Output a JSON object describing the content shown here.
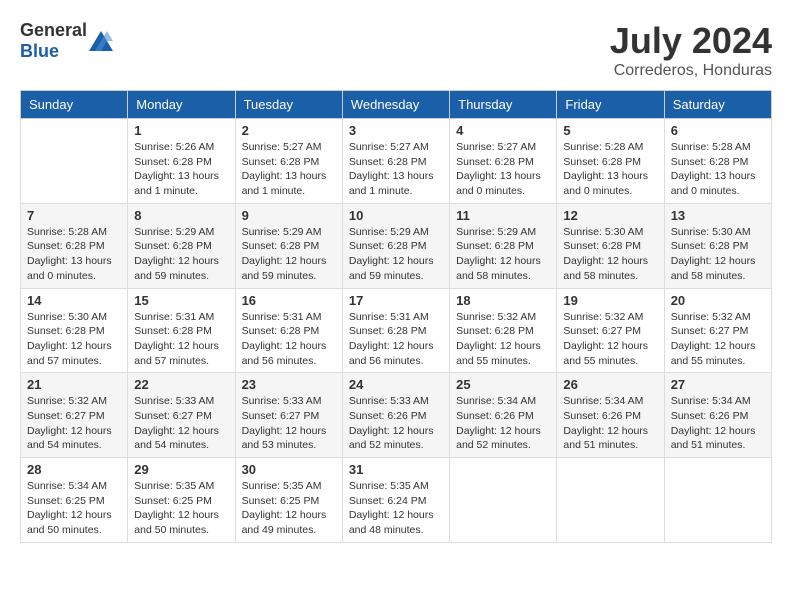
{
  "header": {
    "logo_general": "General",
    "logo_blue": "Blue",
    "month_year": "July 2024",
    "location": "Correderos, Honduras"
  },
  "days_of_week": [
    "Sunday",
    "Monday",
    "Tuesday",
    "Wednesday",
    "Thursday",
    "Friday",
    "Saturday"
  ],
  "weeks": [
    [
      {
        "day": "",
        "info": ""
      },
      {
        "day": "1",
        "info": "Sunrise: 5:26 AM\nSunset: 6:28 PM\nDaylight: 13 hours\nand 1 minute."
      },
      {
        "day": "2",
        "info": "Sunrise: 5:27 AM\nSunset: 6:28 PM\nDaylight: 13 hours\nand 1 minute."
      },
      {
        "day": "3",
        "info": "Sunrise: 5:27 AM\nSunset: 6:28 PM\nDaylight: 13 hours\nand 1 minute."
      },
      {
        "day": "4",
        "info": "Sunrise: 5:27 AM\nSunset: 6:28 PM\nDaylight: 13 hours\nand 0 minutes."
      },
      {
        "day": "5",
        "info": "Sunrise: 5:28 AM\nSunset: 6:28 PM\nDaylight: 13 hours\nand 0 minutes."
      },
      {
        "day": "6",
        "info": "Sunrise: 5:28 AM\nSunset: 6:28 PM\nDaylight: 13 hours\nand 0 minutes."
      }
    ],
    [
      {
        "day": "7",
        "info": "Sunrise: 5:28 AM\nSunset: 6:28 PM\nDaylight: 13 hours\nand 0 minutes."
      },
      {
        "day": "8",
        "info": "Sunrise: 5:29 AM\nSunset: 6:28 PM\nDaylight: 12 hours\nand 59 minutes."
      },
      {
        "day": "9",
        "info": "Sunrise: 5:29 AM\nSunset: 6:28 PM\nDaylight: 12 hours\nand 59 minutes."
      },
      {
        "day": "10",
        "info": "Sunrise: 5:29 AM\nSunset: 6:28 PM\nDaylight: 12 hours\nand 59 minutes."
      },
      {
        "day": "11",
        "info": "Sunrise: 5:29 AM\nSunset: 6:28 PM\nDaylight: 12 hours\nand 58 minutes."
      },
      {
        "day": "12",
        "info": "Sunrise: 5:30 AM\nSunset: 6:28 PM\nDaylight: 12 hours\nand 58 minutes."
      },
      {
        "day": "13",
        "info": "Sunrise: 5:30 AM\nSunset: 6:28 PM\nDaylight: 12 hours\nand 58 minutes."
      }
    ],
    [
      {
        "day": "14",
        "info": "Sunrise: 5:30 AM\nSunset: 6:28 PM\nDaylight: 12 hours\nand 57 minutes."
      },
      {
        "day": "15",
        "info": "Sunrise: 5:31 AM\nSunset: 6:28 PM\nDaylight: 12 hours\nand 57 minutes."
      },
      {
        "day": "16",
        "info": "Sunrise: 5:31 AM\nSunset: 6:28 PM\nDaylight: 12 hours\nand 56 minutes."
      },
      {
        "day": "17",
        "info": "Sunrise: 5:31 AM\nSunset: 6:28 PM\nDaylight: 12 hours\nand 56 minutes."
      },
      {
        "day": "18",
        "info": "Sunrise: 5:32 AM\nSunset: 6:28 PM\nDaylight: 12 hours\nand 55 minutes."
      },
      {
        "day": "19",
        "info": "Sunrise: 5:32 AM\nSunset: 6:27 PM\nDaylight: 12 hours\nand 55 minutes."
      },
      {
        "day": "20",
        "info": "Sunrise: 5:32 AM\nSunset: 6:27 PM\nDaylight: 12 hours\nand 55 minutes."
      }
    ],
    [
      {
        "day": "21",
        "info": "Sunrise: 5:32 AM\nSunset: 6:27 PM\nDaylight: 12 hours\nand 54 minutes."
      },
      {
        "day": "22",
        "info": "Sunrise: 5:33 AM\nSunset: 6:27 PM\nDaylight: 12 hours\nand 54 minutes."
      },
      {
        "day": "23",
        "info": "Sunrise: 5:33 AM\nSunset: 6:27 PM\nDaylight: 12 hours\nand 53 minutes."
      },
      {
        "day": "24",
        "info": "Sunrise: 5:33 AM\nSunset: 6:26 PM\nDaylight: 12 hours\nand 52 minutes."
      },
      {
        "day": "25",
        "info": "Sunrise: 5:34 AM\nSunset: 6:26 PM\nDaylight: 12 hours\nand 52 minutes."
      },
      {
        "day": "26",
        "info": "Sunrise: 5:34 AM\nSunset: 6:26 PM\nDaylight: 12 hours\nand 51 minutes."
      },
      {
        "day": "27",
        "info": "Sunrise: 5:34 AM\nSunset: 6:26 PM\nDaylight: 12 hours\nand 51 minutes."
      }
    ],
    [
      {
        "day": "28",
        "info": "Sunrise: 5:34 AM\nSunset: 6:25 PM\nDaylight: 12 hours\nand 50 minutes."
      },
      {
        "day": "29",
        "info": "Sunrise: 5:35 AM\nSunset: 6:25 PM\nDaylight: 12 hours\nand 50 minutes."
      },
      {
        "day": "30",
        "info": "Sunrise: 5:35 AM\nSunset: 6:25 PM\nDaylight: 12 hours\nand 49 minutes."
      },
      {
        "day": "31",
        "info": "Sunrise: 5:35 AM\nSunset: 6:24 PM\nDaylight: 12 hours\nand 48 minutes."
      },
      {
        "day": "",
        "info": ""
      },
      {
        "day": "",
        "info": ""
      },
      {
        "day": "",
        "info": ""
      }
    ]
  ]
}
